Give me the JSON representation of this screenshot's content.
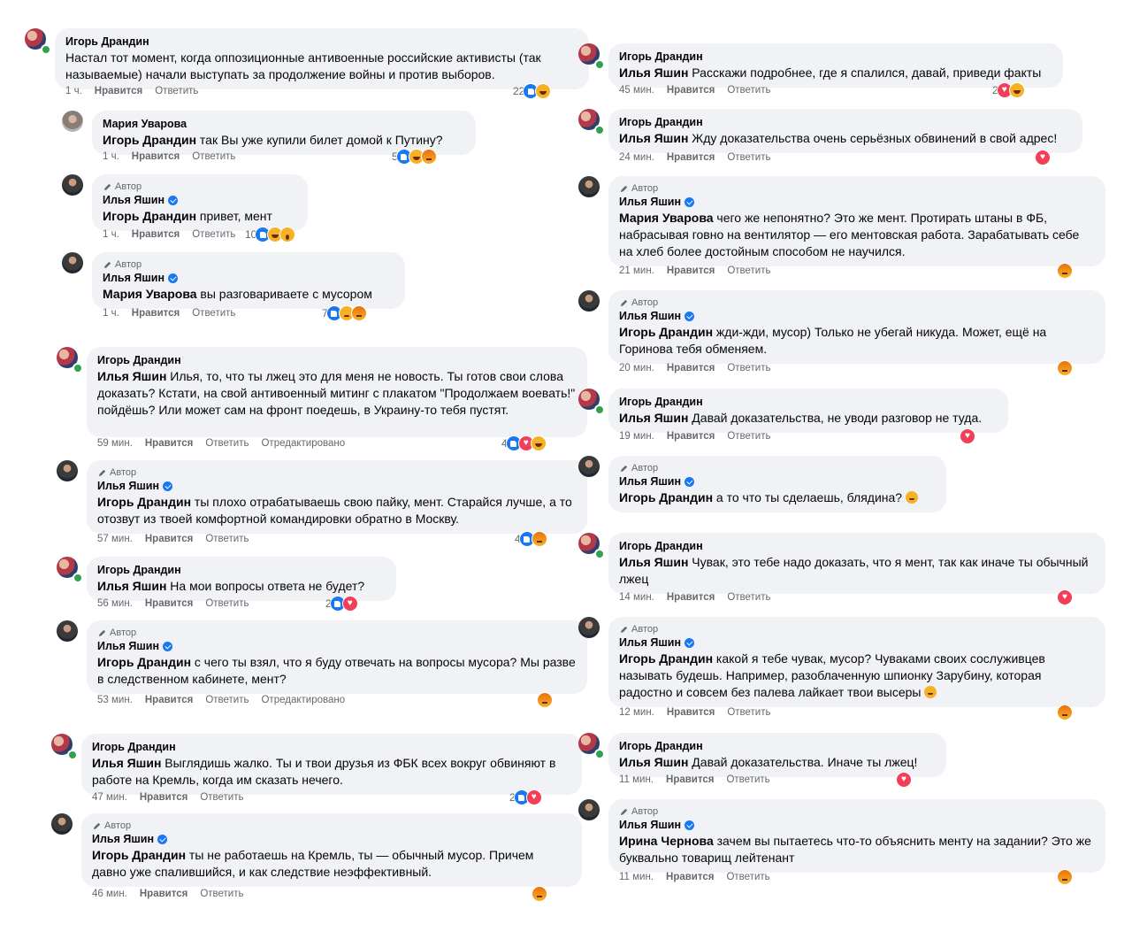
{
  "labels": {
    "like": "Нравится",
    "reply": "Ответить",
    "edited": "Отредактировано",
    "author": "Автор"
  },
  "left": [
    {
      "avatar": "ig",
      "online": true,
      "author_tag": false,
      "verified": false,
      "name": "Игорь Драндин",
      "mention": "",
      "text": "Настал тот момент, когда оппозиционные антивоенные российские активисты (так называемые) начали выступать за продолжение войны и против выборов.",
      "time": "1 ч.",
      "edited": false,
      "react_count": "22",
      "reactions": [
        "like",
        "haha"
      ]
    },
    {
      "avatar": "mu",
      "online": false,
      "author_tag": false,
      "verified": false,
      "name": "Мария Уварова",
      "mention": "Игорь Драндин",
      "text": " так Вы уже купили билет домой к Путину?",
      "time": "1 ч.",
      "edited": false,
      "react_count": "5",
      "reactions": [
        "like",
        "haha",
        "angry"
      ]
    },
    {
      "avatar": "iy",
      "online": false,
      "author_tag": true,
      "verified": true,
      "name": "Илья Яшин",
      "mention": "Игорь Драндин",
      "text": " привет, мент",
      "time": "1 ч.",
      "edited": false,
      "react_count": "10",
      "reactions": [
        "like",
        "haha",
        "wow"
      ]
    },
    {
      "avatar": "iy",
      "online": false,
      "author_tag": true,
      "verified": true,
      "name": "Илья Яшин",
      "mention": "Мария Уварова",
      "text": " вы разговариваете с мусором",
      "time": "1 ч.",
      "edited": false,
      "react_count": "7",
      "reactions": [
        "like",
        "sad",
        "angry"
      ]
    },
    {
      "avatar": "ig",
      "online": true,
      "author_tag": false,
      "verified": false,
      "name": "Игорь Драндин",
      "mention": "Илья Яшин",
      "text": " Илья, то, что ты лжец это для меня не новость. Ты готов свои слова доказать? Кстати, на свой антивоенный митинг с плакатом \"Продолжаем воевать!\" пойдёшь? Или может сам на фронт поедешь, в Украину-то тебя пустят.",
      "time": "59 мин.",
      "edited": true,
      "react_count": "4",
      "reactions": [
        "like",
        "love",
        "haha"
      ]
    },
    {
      "avatar": "iy",
      "online": false,
      "author_tag": true,
      "verified": true,
      "name": "Илья Яшин",
      "mention": "Игорь Драндин",
      "text": " ты плохо отрабатываешь свою пайку, мент. Старайся лучше, а то отозвут из твоей комфортной командировки обратно в Москву.",
      "time": "57 мин.",
      "edited": false,
      "react_count": "4",
      "reactions": [
        "like",
        "angry"
      ]
    },
    {
      "avatar": "ig",
      "online": true,
      "author_tag": false,
      "verified": false,
      "name": "Игорь Драндин",
      "mention": "Илья Яшин",
      "text": " На мои вопросы ответа не будет?",
      "time": "56 мин.",
      "edited": false,
      "react_count": "2",
      "reactions": [
        "like",
        "love"
      ]
    },
    {
      "avatar": "iy",
      "online": false,
      "author_tag": true,
      "verified": true,
      "name": "Илья Яшин",
      "mention": "Игорь Драндин",
      "text": " с чего ты взял, что я буду отвечать на вопросы мусора? Мы разве в следственном кабинете, мент?",
      "time": "53 мин.",
      "edited": true,
      "react_count": "",
      "reactions": [
        "angry"
      ]
    },
    {
      "avatar": "ig",
      "online": true,
      "author_tag": false,
      "verified": false,
      "name": "Игорь Драндин",
      "mention": "Илья Яшин",
      "text": " Выглядишь жалко. Ты и твои друзья из ФБК всех вокруг обвиняют в работе на Кремль, когда им сказать нечего.",
      "time": "47 мин.",
      "edited": false,
      "react_count": "2",
      "reactions": [
        "like",
        "love"
      ]
    },
    {
      "avatar": "iy",
      "online": false,
      "author_tag": true,
      "verified": true,
      "name": "Илья Яшин",
      "mention": "Игорь Драндин",
      "text": " ты не работаешь на Кремль, ты — обычный мусор. Причем давно уже спалившийся, и как следствие неэффективный.",
      "time": "46 мин.",
      "edited": false,
      "react_count": "",
      "reactions": [
        "angry"
      ]
    }
  ],
  "right": [
    {
      "avatar": "ig",
      "online": true,
      "author_tag": false,
      "verified": false,
      "name": "Игорь Драндин",
      "mention": "Илья Яшин",
      "text": " Расскажи подробнее, где я спалился, давай, приведи факты",
      "time": "45 мин.",
      "edited": false,
      "react_count": "2",
      "reactions": [
        "love",
        "haha"
      ]
    },
    {
      "avatar": "ig",
      "online": true,
      "author_tag": false,
      "verified": false,
      "name": "Игорь Драндин",
      "mention": "Илья Яшин",
      "text": " Жду доказательства очень серьёзных обвинений в свой адрес!",
      "time": "24 мин.",
      "edited": false,
      "react_count": "",
      "reactions": [
        "love"
      ]
    },
    {
      "avatar": "iy",
      "online": false,
      "author_tag": true,
      "verified": true,
      "name": "Илья Яшин",
      "mention": "Мария Уварова",
      "text": " чего же непонятно? Это же мент. Протирать штаны в ФБ, набрасывая говно на вентилятор — его ментовская работа. Зарабатывать себе на хлеб более достойным способом не научился.",
      "time": "21 мин.",
      "edited": false,
      "react_count": "",
      "reactions": [
        "angry"
      ]
    },
    {
      "avatar": "iy",
      "online": false,
      "author_tag": true,
      "verified": true,
      "name": "Илья Яшин",
      "mention": "Игорь Драндин",
      "text": " жди-жди, мусор) Только не убегай никуда. Может, ещё на Горинова тебя обменяем.",
      "time": "20 мин.",
      "edited": false,
      "react_count": "",
      "reactions": [
        "angry"
      ]
    },
    {
      "avatar": "ig",
      "online": true,
      "author_tag": false,
      "verified": false,
      "name": "Игорь Драндин",
      "mention": "Илья Яшин",
      "text": " Давай доказательства, не уводи разговор не туда.",
      "time": "19 мин.",
      "edited": false,
      "react_count": "",
      "reactions": [
        "love"
      ]
    },
    {
      "avatar": "iy",
      "online": false,
      "author_tag": true,
      "verified": true,
      "name": "Илья Яшин",
      "mention": "Игорь Драндин",
      "text": " а то что ты сделаешь, блядина?",
      "emoji": true,
      "time": "",
      "edited": false,
      "react_count": "",
      "reactions": []
    },
    {
      "avatar": "ig",
      "online": true,
      "author_tag": false,
      "verified": false,
      "name": "Игорь Драндин",
      "mention": "Илья Яшин",
      "text": " Чувак, это тебе надо доказать, что я мент, так как иначе ты обычный лжец",
      "time": "14 мин.",
      "edited": false,
      "react_count": "",
      "reactions": [
        "love"
      ]
    },
    {
      "avatar": "iy",
      "online": false,
      "author_tag": true,
      "verified": true,
      "name": "Илья Яшин",
      "mention": "Игорь Драндин",
      "text": " какой я тебе чувак, мусор? Чуваками своих сослуживцев называть будешь. Например, разоблаченную шпионку Зарубину, которая радостно и совсем без палева лайкает твои высеры",
      "emoji": true,
      "time": "12 мин.",
      "edited": false,
      "react_count": "",
      "reactions": [
        "angry"
      ]
    },
    {
      "avatar": "ig",
      "online": true,
      "author_tag": false,
      "verified": false,
      "name": "Игорь Драндин",
      "mention": "Илья Яшин",
      "text": " Давай доказательства. Иначе ты лжец!",
      "time": "11 мин.",
      "edited": false,
      "react_count": "",
      "reactions": [
        "love"
      ]
    },
    {
      "avatar": "iy",
      "online": false,
      "author_tag": true,
      "verified": true,
      "name": "Илья Яшин",
      "mention": "Ирина Чернова",
      "text": " зачем вы пытаетесь что-то объяснить менту на задании? Это же буквально товарищ лейтенант",
      "time": "11 мин.",
      "edited": false,
      "react_count": "",
      "reactions": [
        "angry"
      ]
    }
  ]
}
